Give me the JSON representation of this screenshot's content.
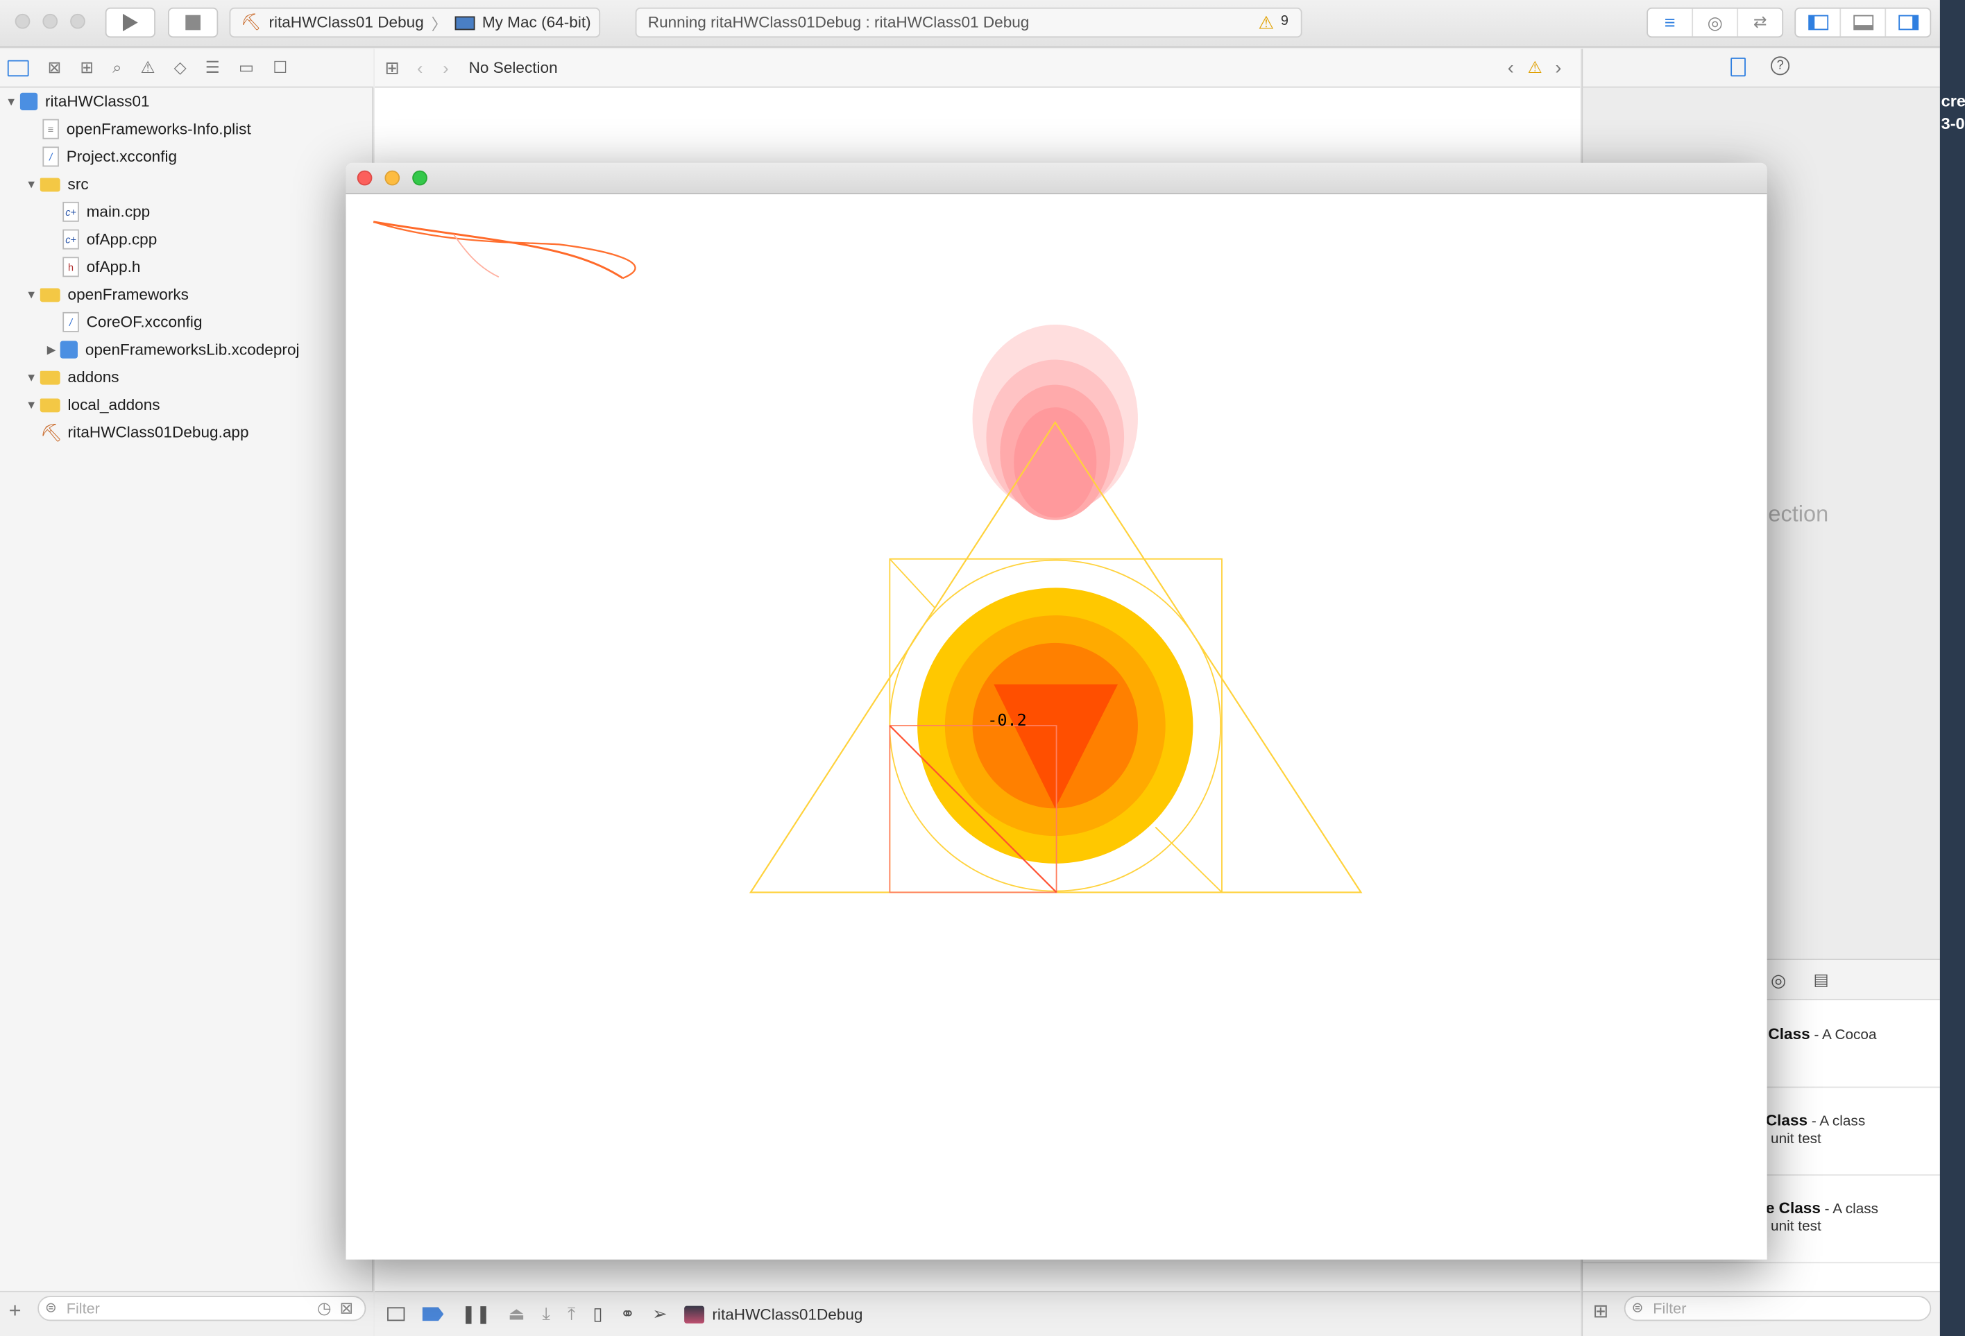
{
  "toolbar": {
    "scheme_target": "ritaHWClass01 Debug",
    "destination": "My Mac (64-bit)",
    "status_text": "Running ritaHWClass01Debug : ritaHWClass01 Debug",
    "warning_count": "9"
  },
  "jumpbar": {
    "selection": "No Selection"
  },
  "navigator": {
    "items": [
      {
        "label": "ritaHWClass01",
        "icon": "project-icon",
        "expanded": true
      },
      {
        "label": "openFrameworks-Info.plist",
        "icon": "plist-file-icon"
      },
      {
        "label": "Project.xcconfig",
        "icon": "xcconfig-file-icon"
      },
      {
        "label": "src",
        "icon": "folder-icon",
        "expanded": true
      },
      {
        "label": "main.cpp",
        "icon": "cpp-file-icon"
      },
      {
        "label": "ofApp.cpp",
        "icon": "cpp-file-icon"
      },
      {
        "label": "ofApp.h",
        "icon": "header-file-icon"
      },
      {
        "label": "openFrameworks",
        "icon": "folder-icon",
        "expanded": true
      },
      {
        "label": "CoreOF.xcconfig",
        "icon": "xcconfig-file-icon"
      },
      {
        "label": "openFrameworksLib.xcodeproj",
        "icon": "project-icon",
        "expanded": false
      },
      {
        "label": "addons",
        "icon": "folder-icon",
        "expanded": true
      },
      {
        "label": "local_addons",
        "icon": "folder-icon",
        "expanded": true
      },
      {
        "label": "ritaHWClass01Debug.app",
        "icon": "app-icon"
      }
    ],
    "filter_placeholder": "Filter"
  },
  "inspector": {
    "no_selection_fragment": "ection",
    "library_items": [
      {
        "title": "Class",
        "desc": "- A Cocoa",
        "desc2": ""
      },
      {
        "title": "Class",
        "desc": "- A class",
        "desc2": "unit test"
      },
      {
        "title": "e Class",
        "desc": "- A class",
        "desc2": "unit test"
      }
    ],
    "filter_placeholder": "Filter"
  },
  "debugbar": {
    "process": "ritaHWClass01Debug"
  },
  "desktop_fragments": {
    "line1": "cre",
    "line2": "3-0"
  },
  "canvas": {
    "label": "-0.2"
  },
  "colors": {
    "accent": "#2f7fe0",
    "orange_line": "#ff6a2a",
    "yellow_outer": "#ffc800",
    "amber": "#ffaa00",
    "orange_mid": "#ff7f00",
    "red_orange": "#ff4f00",
    "pink": "#ff9aa0"
  }
}
